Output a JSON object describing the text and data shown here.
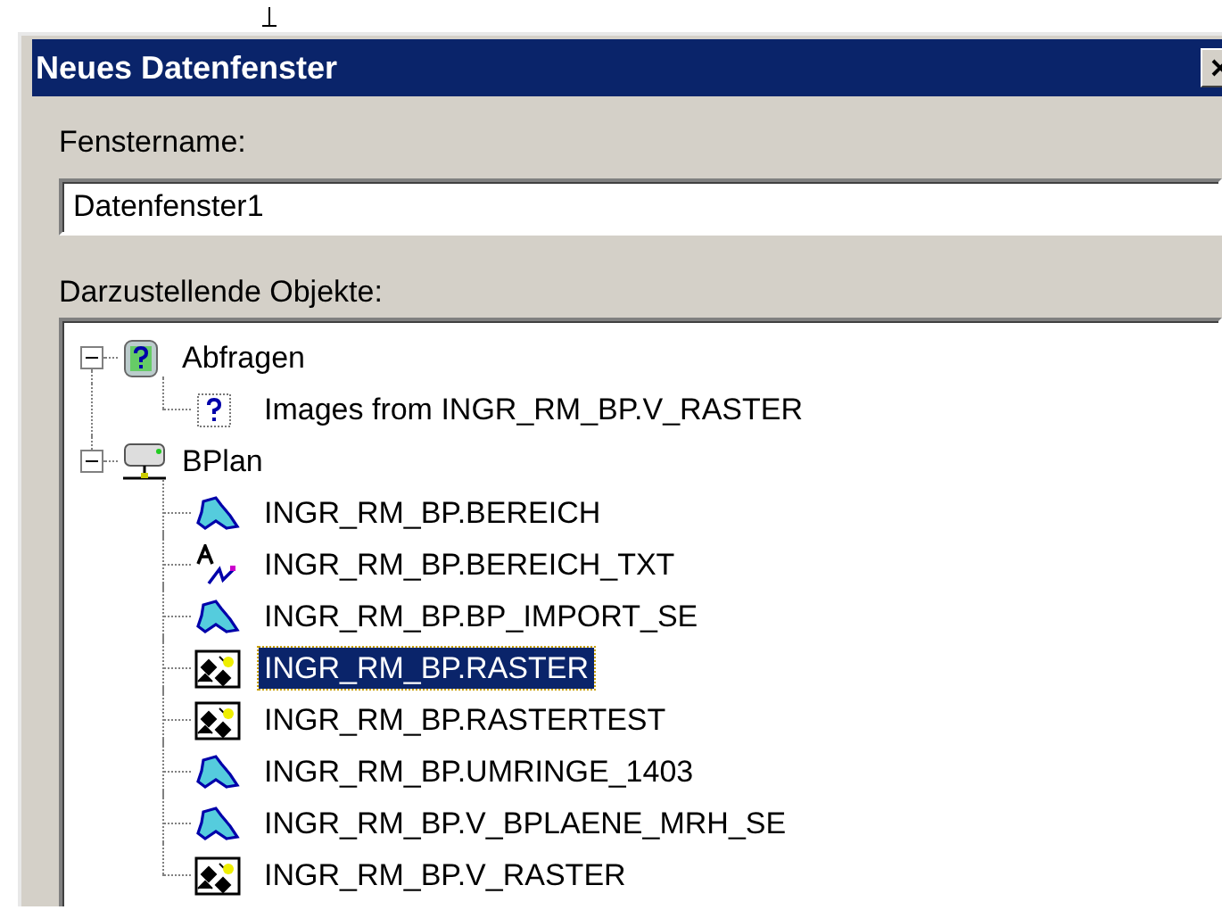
{
  "window": {
    "title": "Neues Datenfenster"
  },
  "name_field": {
    "label": "Fenstername:",
    "value": "Datenfenster1"
  },
  "objects": {
    "label": "Darzustellende Objekte:",
    "tree": [
      {
        "label": "Abfragen",
        "kind": "queries",
        "expanded": true,
        "selected": false,
        "children": [
          {
            "label": "Images from INGR_RM_BP.V_RASTER",
            "kind": "query",
            "selected": false
          }
        ]
      },
      {
        "label": "BPlan",
        "kind": "database",
        "expanded": true,
        "selected": false,
        "children": [
          {
            "label": "INGR_RM_BP.BEREICH",
            "kind": "area",
            "selected": false
          },
          {
            "label": "INGR_RM_BP.BEREICH_TXT",
            "kind": "text",
            "selected": false
          },
          {
            "label": "INGR_RM_BP.BP_IMPORT_SE",
            "kind": "area",
            "selected": false
          },
          {
            "label": "INGR_RM_BP.RASTER",
            "kind": "raster",
            "selected": true
          },
          {
            "label": "INGR_RM_BP.RASTERTEST",
            "kind": "raster",
            "selected": false
          },
          {
            "label": "INGR_RM_BP.UMRINGE_1403",
            "kind": "area",
            "selected": false
          },
          {
            "label": "INGR_RM_BP.V_BPLAENE_MRH_SE",
            "kind": "area",
            "selected": false
          },
          {
            "label": "INGR_RM_BP.V_RASTER",
            "kind": "raster",
            "selected": false
          }
        ]
      }
    ]
  }
}
